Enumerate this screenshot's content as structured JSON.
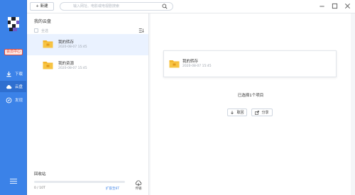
{
  "sidebar": {
    "member_badge": "会员中心",
    "items": [
      {
        "label": "下载",
        "icon": "download-icon"
      },
      {
        "label": "云盘",
        "icon": "cloud-icon"
      },
      {
        "label": "发现",
        "icon": "discover-icon"
      }
    ],
    "menu_icon": "hamburger-menu-icon",
    "accent_color": "#3b82e8"
  },
  "topbar": {
    "new_label": "+ 新建",
    "search_placeholder": "输入网址、电影或电视剧搜索",
    "search_icon": "search-icon",
    "window_controls": [
      "minimize-icon",
      "maximize-icon",
      "close-icon"
    ]
  },
  "list": {
    "title": "我的云盘",
    "select_all": "全选",
    "files": [
      {
        "name": "我的转存",
        "date": "2020-08-07 15:45"
      },
      {
        "name": "我的资源",
        "date": "2020-08-07 15:45"
      }
    ],
    "recycle_bin": "回收站",
    "storage": "0 / 10T",
    "expand": "扩容至6T",
    "transfer": "传输"
  },
  "detail": {
    "name": "我的转存",
    "date": "2020-08-07 15:45",
    "selected_count": "已选择1个项目",
    "retrieve": "取回",
    "share": "分享"
  }
}
